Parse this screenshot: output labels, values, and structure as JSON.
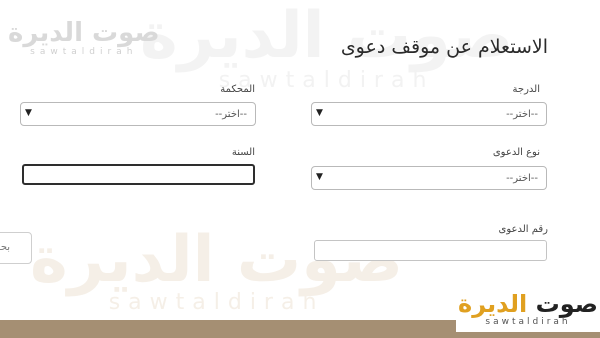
{
  "watermark": {
    "arabic": "صوت الديرة",
    "latin": "sawtaldirah"
  },
  "logo": {
    "part1": "صوت",
    "part2": "الديرة",
    "latin": "sawtaldirah"
  },
  "title": "الاستعلام عن موقف دعوى",
  "form": {
    "degree_label": "الدرجة",
    "degree_value": "--اختر--",
    "court_label": "المحكمة",
    "court_value": "--اختر--",
    "case_type_label": "نوع الدعوى",
    "case_type_value": "--اختر--",
    "year_label": "السنة",
    "year_value": "",
    "case_number_label": "رقم الدعوى",
    "case_number_value": ""
  },
  "search_button": "بحث",
  "colors": {
    "accent_bar": "#a58f73",
    "logo_gold": "#e0a020"
  }
}
